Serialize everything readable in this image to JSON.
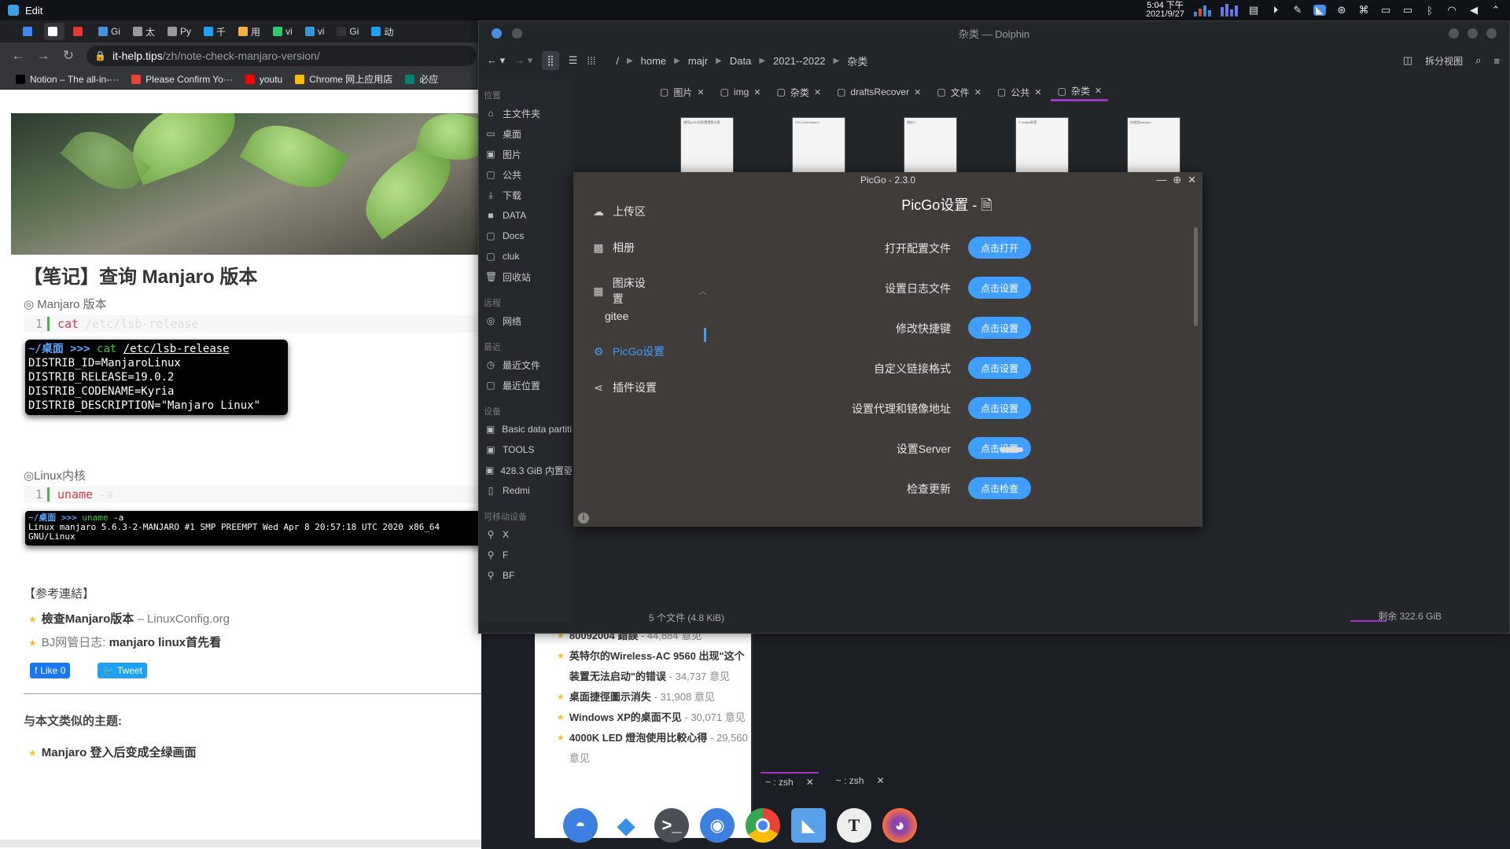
{
  "top_panel": {
    "app_menu": "Edit",
    "clock_time": "5:04 下午",
    "clock_date": "2021/9/27"
  },
  "chrome": {
    "tabs": [
      {
        "label": "",
        "color": "#4285f4"
      },
      {
        "label": "",
        "color": "#ffffff"
      },
      {
        "label": "",
        "color": "#e53935"
      },
      {
        "label": "Gi",
        "color": "#4a90e2"
      },
      {
        "label": "太",
        "color": "#999999"
      },
      {
        "label": "Py",
        "color": "#999999"
      },
      {
        "label": "千",
        "color": "#1da1f2"
      },
      {
        "label": "用",
        "color": "#f5b041"
      },
      {
        "label": "vi",
        "color": "#2ecc71"
      },
      {
        "label": "vi",
        "color": "#3498db"
      },
      {
        "label": "Gi",
        "color": "#333333"
      },
      {
        "label": "动",
        "color": "#1da1f2"
      }
    ],
    "url_domain": "it-help.tips",
    "url_path": "/zh/note-check-manjaro-version/",
    "bookmarks": [
      {
        "label": "Notion – The all-in-···",
        "color": "#000000"
      },
      {
        "label": "Please Confirm Yo···",
        "color": "#ea4335"
      },
      {
        "label": "youtu",
        "color": "#ff0000"
      },
      {
        "label": "Chrome 网上应用店",
        "color": "#fbbc05"
      },
      {
        "label": "必应",
        "color": "#008373"
      }
    ]
  },
  "article": {
    "title": "【笔记】查询 Manjaro 版本",
    "section1": "◎ Manjaro 版本",
    "code1_ln": "1",
    "code1_cmd": "cat",
    "code1_arg": "/etc/lsb-release",
    "term1_prompt": "~/桌面 >>>",
    "term1_cmd": "cat",
    "term1_arg": "/etc/lsb-release",
    "term1_lines": [
      "DISTRIB_ID=ManjaroLinux",
      "DISTRIB_RELEASE=19.0.2",
      "DISTRIB_CODENAME=Kyria",
      "DISTRIB_DESCRIPTION=\"Manjaro Linux\""
    ],
    "section2": "◎Linux内核",
    "code2_ln": "1",
    "code2_cmd": "uname",
    "code2_arg": "-a",
    "term2_prompt": "~/桌面 >>>",
    "term2_cmd": "uname",
    "term2_arg": "-a",
    "term2_lines": [
      "Linux manjaro 5.6.3-2-MANJARO #1 SMP PREEMPT Wed Apr 8 20:57:18 UTC 2020 x86_64",
      "GNU/Linux"
    ],
    "refs_heading": "【参考連結】",
    "ref1_bold": "檢查Manjaro版本",
    "ref1_rest": " – LinuxConfig.org",
    "ref2_pre": "BJ网管日志: ",
    "ref2_bold": "manjaro linux首先看",
    "like_label": "Like 0",
    "tweet_label": "Tweet",
    "similar_heading": "与本文类似的主题:",
    "similar_item": "Manjaro 登入后变成全绿画面"
  },
  "sidebar_list": [
    {
      "title": "80092004 錯誤",
      "count": " - 44,884 意见"
    },
    {
      "title": "英特尔的Wireless-AC 9560 出现\"这个装置无法启动\"的错误",
      "count": " - 34,737 意见"
    },
    {
      "title": "桌面捷徑圖示消失",
      "count": " - 31,908 意见"
    },
    {
      "title": "Windows XP的桌面不见",
      "count": " - 30,071 意见"
    },
    {
      "title": "4000K LED 燈泡使用比較心得",
      "count": " - 29,560 意见"
    }
  ],
  "konsole": {
    "tabs": [
      "~ : zsh",
      "~ : zsh"
    ]
  },
  "dolphin": {
    "title": "杂类 — Dolphin",
    "breadcrumbs": [
      "/",
      "home",
      "majr",
      "Data",
      "2021--2022",
      "杂类"
    ],
    "split_label": "拆分视图",
    "places_heading": "位置",
    "places": [
      {
        "icon": "⌂",
        "label": "主文件夹"
      },
      {
        "icon": "▭",
        "label": "桌面"
      },
      {
        "icon": "▣",
        "label": "图片"
      },
      {
        "icon": "▢",
        "label": "公共"
      },
      {
        "icon": "⤓",
        "label": "下载"
      },
      {
        "icon": "■",
        "label": "DATA"
      },
      {
        "icon": "▢",
        "label": "Docs"
      },
      {
        "icon": "▢",
        "label": "cluk"
      },
      {
        "icon": "🗑",
        "label": "回收站"
      }
    ],
    "remote_heading": "远程",
    "remote": [
      {
        "icon": "◎",
        "label": "网络"
      }
    ],
    "recent_heading": "最近",
    "recent": [
      {
        "icon": "◷",
        "label": "最近文件"
      },
      {
        "icon": "▢",
        "label": "最近位置"
      }
    ],
    "devices_heading": "设备",
    "devices": [
      {
        "icon": "▣",
        "label": "Basic data partiti"
      },
      {
        "icon": "▣",
        "label": "TOOLS"
      },
      {
        "icon": "▣",
        "label": "428.3 GiB 内置驱"
      },
      {
        "icon": "▯",
        "label": "Redmi"
      }
    ],
    "removable_heading": "可移动设备",
    "removable": [
      {
        "icon": "⚲",
        "label": "X"
      },
      {
        "icon": "⚲",
        "label": "F"
      },
      {
        "icon": "⚲",
        "label": "BF"
      }
    ],
    "tabs": [
      "图片",
      "img",
      "杂类",
      "draftsRecover",
      "文件",
      "公共",
      "杂类"
    ],
    "status_count": "5 个文件 (4.8 KiB)",
    "status_free": "剩余 322.6 GiB",
    "thumbs": [
      "使用picGo时配置需要注意",
      "GDI consolidated",
      "增加 /t",
      "Y scripts配置",
      "在使用Manjaro"
    ]
  },
  "picgo": {
    "window_title": "PicGo - 2.3.0",
    "heading": "PicGo设置 - ",
    "nav": [
      {
        "icon": "☁",
        "label": "上传区"
      },
      {
        "icon": "▩",
        "label": "相册"
      },
      {
        "icon": "▦",
        "label": "图床设置"
      },
      {
        "icon": "",
        "label": "gitee"
      },
      {
        "icon": "⚙",
        "label": "PicGo设置"
      },
      {
        "icon": "⋖",
        "label": "插件设置"
      }
    ],
    "settings": [
      {
        "label": "打开配置文件",
        "button": "点击打开"
      },
      {
        "label": "设置日志文件",
        "button": "点击设置"
      },
      {
        "label": "修改快捷键",
        "button": "点击设置"
      },
      {
        "label": "自定义链接格式",
        "button": "点击设置"
      },
      {
        "label": "设置代理和镜像地址",
        "button": "点击设置"
      },
      {
        "label": "设置Server",
        "button": "点击设置"
      },
      {
        "label": "检查更新",
        "button": "点击检查"
      }
    ]
  }
}
